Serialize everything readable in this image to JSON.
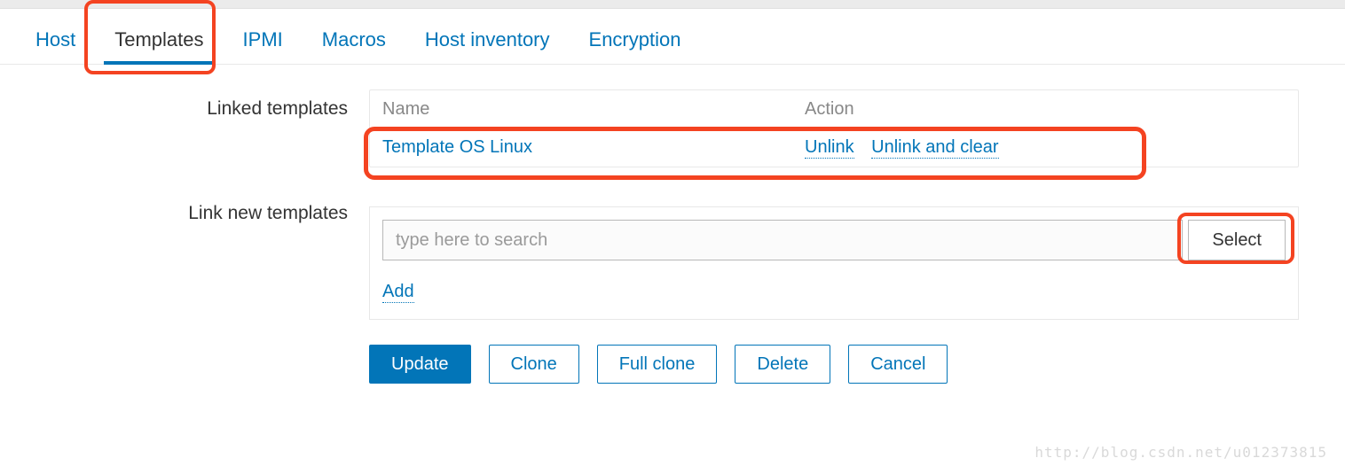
{
  "tabs": {
    "host": "Host",
    "templates": "Templates",
    "ipmi": "IPMI",
    "macros": "Macros",
    "host_inventory": "Host inventory",
    "encryption": "Encryption"
  },
  "labels": {
    "linked_templates": "Linked templates",
    "link_new_templates": "Link new templates"
  },
  "linked_templates_table": {
    "head_name": "Name",
    "head_action": "Action",
    "rows": [
      {
        "name": "Template OS Linux",
        "action_unlink": "Unlink",
        "action_unlink_clear": "Unlink and clear"
      }
    ]
  },
  "link_new": {
    "search_placeholder": "type here to search",
    "select_label": "Select",
    "add_label": "Add"
  },
  "buttons": {
    "update": "Update",
    "clone": "Clone",
    "full_clone": "Full clone",
    "delete": "Delete",
    "cancel": "Cancel"
  },
  "watermark": "http://blog.csdn.net/u012373815"
}
